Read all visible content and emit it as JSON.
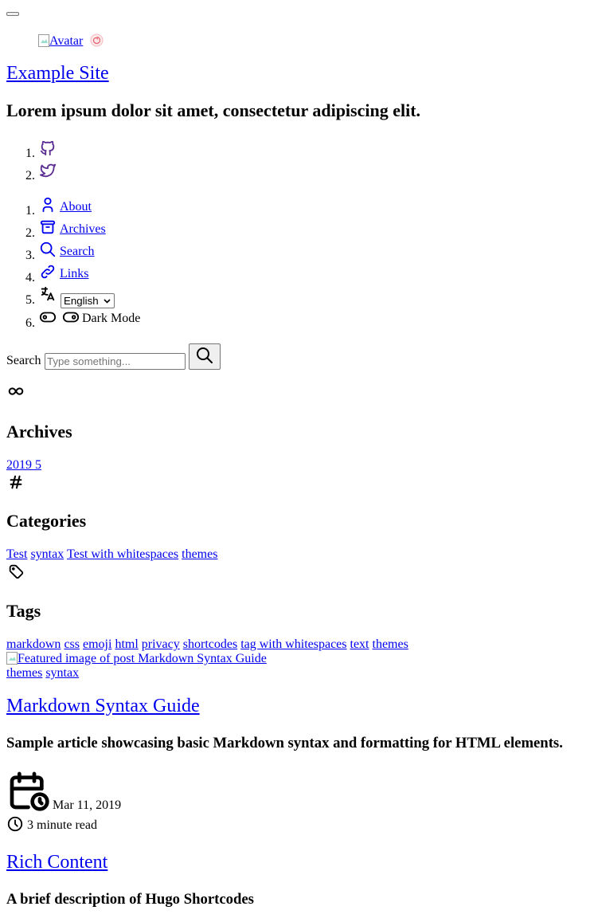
{
  "header": {
    "avatar_alt": "Avatar",
    "site_title": "Example Site",
    "site_description": "Lorem ipsum dolor sit amet, consectetur adipiscing elit."
  },
  "social": {
    "items": [
      {
        "number": "1.",
        "icon": "github-icon"
      },
      {
        "number": "2.",
        "icon": "twitter-icon"
      }
    ]
  },
  "menu": {
    "items": [
      {
        "number": "1.",
        "icon": "user-icon",
        "label": "About"
      },
      {
        "number": "2.",
        "icon": "archive-icon",
        "label": "Archives"
      },
      {
        "number": "3.",
        "icon": "search-icon",
        "label": "Search"
      },
      {
        "number": "4.",
        "icon": "link-icon",
        "label": "Links"
      },
      {
        "number": "5.",
        "icon": "language-icon",
        "selected_language": "English"
      },
      {
        "number": "6.",
        "icon": "toggle-icon",
        "label": "Dark Mode"
      }
    ]
  },
  "search": {
    "label": "Search",
    "placeholder": "Type something..."
  },
  "widgets": {
    "archives": {
      "icon": "infinity-icon",
      "title": "Archives",
      "year": "2019",
      "count": "5"
    },
    "categories": {
      "icon": "hash-icon",
      "title": "Categories",
      "items": [
        "Test",
        "syntax",
        "Test with whitespaces",
        "themes"
      ]
    },
    "tags": {
      "icon": "tag-icon",
      "title": "Tags",
      "items": [
        "markdown",
        "css",
        "emoji",
        "html",
        "privacy",
        "shortcodes",
        "tag with whitespaces",
        "text",
        "themes"
      ]
    }
  },
  "posts": [
    {
      "featured_image_alt": "Featured image of post Markdown Syntax Guide",
      "categories": [
        "themes",
        "syntax"
      ],
      "title": "Markdown Syntax Guide",
      "subtitle": "Sample article showcasing basic Markdown syntax and formatting for HTML elements.",
      "date": "Mar 11, 2019",
      "reading_time": "3 minute read"
    },
    {
      "title": "Rich Content",
      "subtitle": "A brief description of Hugo Shortcodes"
    }
  ],
  "colors": {
    "link": "#0000ee",
    "social_icon": "#5a2d91",
    "menu_icon": "#0000ee"
  }
}
